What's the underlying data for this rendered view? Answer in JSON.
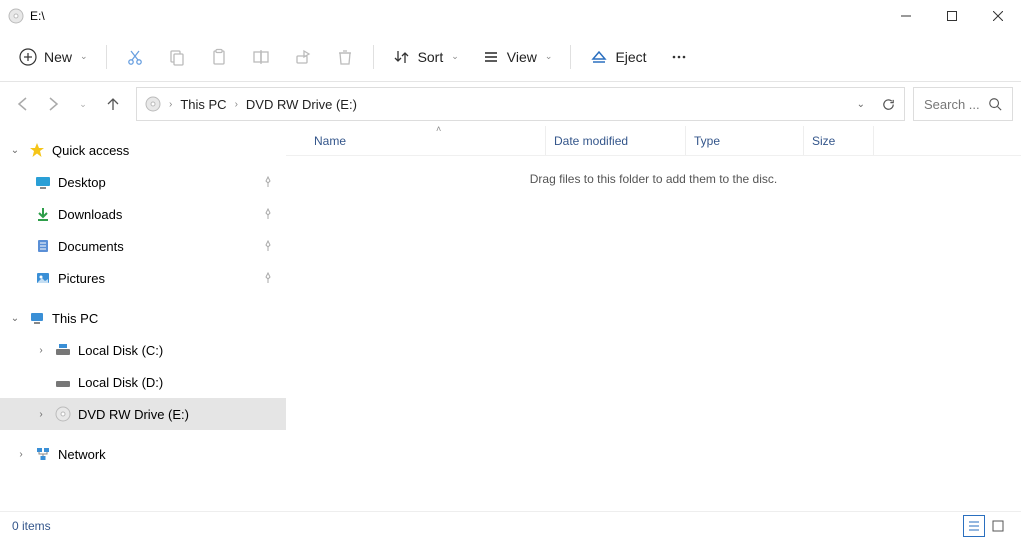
{
  "window": {
    "title": "E:\\"
  },
  "toolbar": {
    "new_label": "New",
    "sort_label": "Sort",
    "view_label": "View",
    "eject_label": "Eject"
  },
  "breadcrumb": {
    "root": "This PC",
    "current": "DVD RW Drive (E:)"
  },
  "search": {
    "placeholder": "Search ..."
  },
  "columns": {
    "name": "Name",
    "date": "Date modified",
    "type": "Type",
    "size": "Size"
  },
  "content": {
    "empty_message": "Drag files to this folder to add them to the disc."
  },
  "sidebar": {
    "quick_access": "Quick access",
    "desktop": "Desktop",
    "downloads": "Downloads",
    "documents": "Documents",
    "pictures": "Pictures",
    "this_pc": "This PC",
    "local_c": "Local Disk (C:)",
    "local_d": "Local Disk (D:)",
    "dvd_e": "DVD RW Drive (E:)",
    "network": "Network"
  },
  "status": {
    "items": "0 items"
  }
}
